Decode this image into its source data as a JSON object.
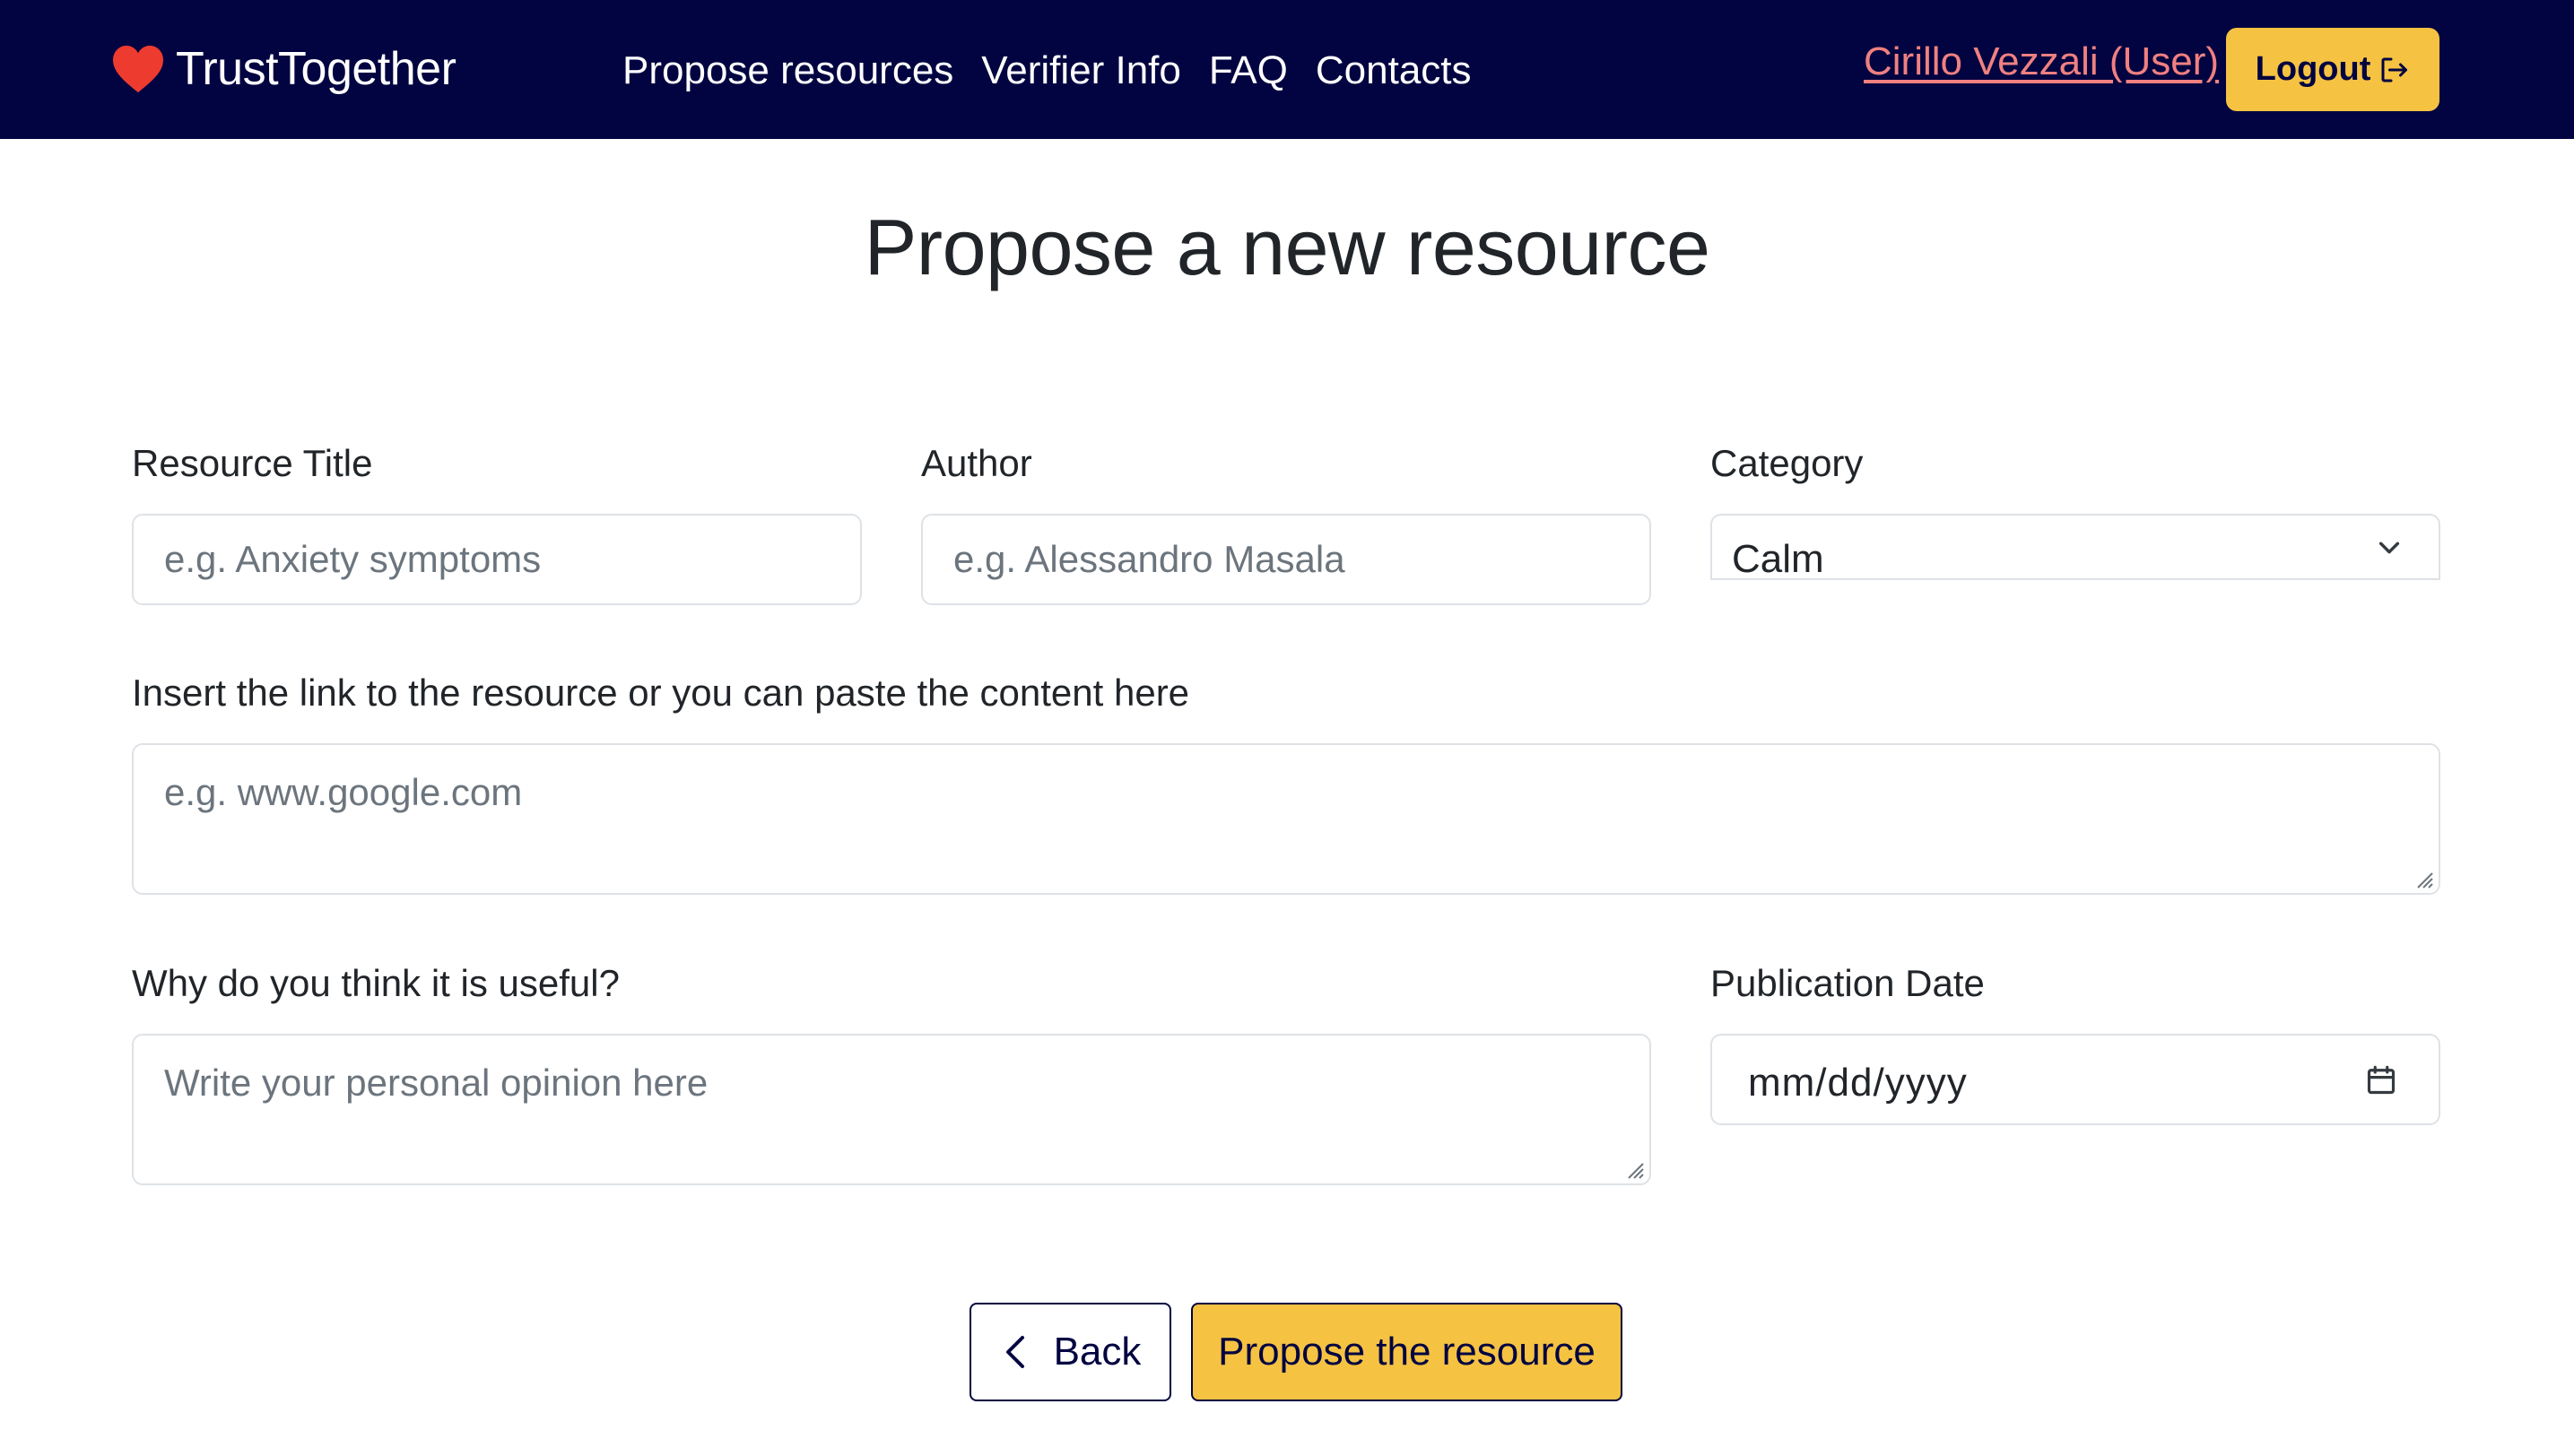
{
  "navbar": {
    "brand": "TrustTogether",
    "links": [
      "Propose resources",
      "Verifier Info",
      "FAQ",
      "Contacts"
    ],
    "user": "Cirillo Vezzali (User)",
    "logout_label": "Logout",
    "background_color": "#010440",
    "accent_color": "#f5c242",
    "user_link_color": "#f08080",
    "icons": [
      "heart-icon",
      "logout-icon"
    ]
  },
  "form": {
    "title": "Propose a new resource",
    "resource_title": {
      "label": "Resource Title",
      "placeholder": "e.g. Anxiety symptoms",
      "value": ""
    },
    "author": {
      "label": "Author",
      "placeholder": "e.g. Alessandro Masala",
      "value": ""
    },
    "category": {
      "label": "Category",
      "selected": "Calm"
    },
    "link": {
      "label": "Insert the link to the resource or you can paste the content here",
      "placeholder": "e.g. www.google.com",
      "value": ""
    },
    "usefulness": {
      "label": "Why do you think it is useful?",
      "placeholder": "Write your personal opinion here",
      "value": ""
    },
    "publication_date": {
      "label": "Publication Date",
      "placeholder": "mm/dd/yyyy"
    }
  },
  "actions": {
    "back_label": "Back",
    "submit_label": "Propose the resource"
  }
}
